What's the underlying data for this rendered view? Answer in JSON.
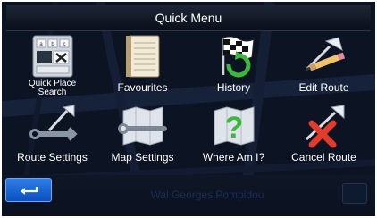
{
  "header": {
    "title": "Quick Menu"
  },
  "menu": {
    "items": [
      {
        "label": "Quick Place Search",
        "icon": "keypad-search-icon"
      },
      {
        "label": "Favourites",
        "icon": "notebook-icon"
      },
      {
        "label": "History",
        "icon": "checkered-flag-history-icon"
      },
      {
        "label": "Edit Route",
        "icon": "pencil-route-icon"
      },
      {
        "label": "Route Settings",
        "icon": "wrench-route-icon"
      },
      {
        "label": "Map Settings",
        "icon": "wrench-map-icon"
      },
      {
        "label": "Where Am I?",
        "icon": "question-map-icon"
      },
      {
        "label": "Cancel Route",
        "icon": "cancel-route-icon"
      }
    ]
  },
  "footer": {
    "back_icon": "return-arrow-icon",
    "street": "Wal Georges Pompidou"
  },
  "colors": {
    "accent": "#1a66d6",
    "background": "#0c1322",
    "text": "#ffffff"
  }
}
